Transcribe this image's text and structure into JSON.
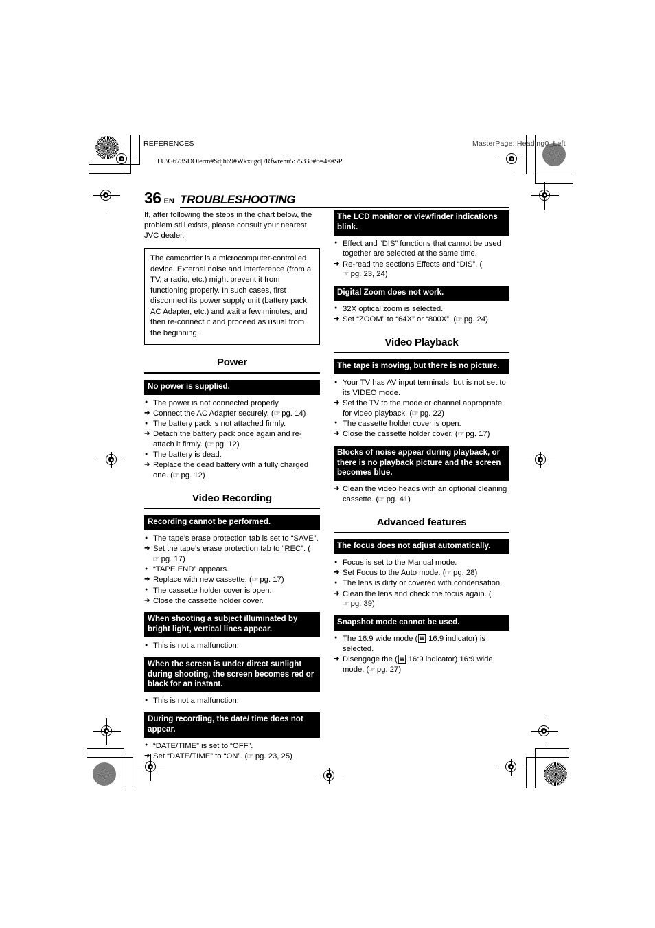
{
  "header": {
    "left_label": "REFERENCES",
    "garbled_line": "J U\\G673SDOlerrn#Sdjh69#Wkxugd| /Rfwrehu5: /5338#6=4<#SP",
    "right_label": "MasterPage: Heading0_Left"
  },
  "page": {
    "number": "36",
    "language": "EN",
    "title": "TROUBLESHOOTING"
  },
  "intro": "If, after following the steps in the chart below, the problem still exists, please consult your nearest JVC dealer.",
  "note_box": "The camcorder is a microcomputer-controlled device. External noise and interference (from a TV, a radio, etc.) might prevent it from functioning properly. In such cases, first disconnect its power supply unit (battery pack, AC Adapter, etc.) and wait a few minutes; and then re-connect it and proceed as usual from the beginning.",
  "sections": {
    "power": {
      "heading": "Power",
      "problems": [
        {
          "title": "No power is supplied.",
          "items": [
            {
              "type": "bullet",
              "text": "The power is not connected properly."
            },
            {
              "type": "arrow",
              "text": "Connect the AC Adapter securely. (",
              "ref": "pg. 14",
              "tail": ")"
            },
            {
              "type": "bullet",
              "text": "The battery pack is not attached firmly."
            },
            {
              "type": "arrow",
              "text": "Detach the battery pack once again and re-attach it firmly. (",
              "ref": "pg. 12",
              "tail": ")"
            },
            {
              "type": "bullet",
              "text": "The battery is dead."
            },
            {
              "type": "arrow",
              "text": "Replace the dead battery with a fully charged one. (",
              "ref": "pg. 12",
              "tail": ")"
            }
          ]
        }
      ]
    },
    "video_recording": {
      "heading": "Video Recording",
      "problems": [
        {
          "title": "Recording cannot be performed.",
          "items": [
            {
              "type": "bullet",
              "text": "The tape’s erase protection tab is set to “SAVE”."
            },
            {
              "type": "arrow",
              "text": "Set the tape’s erase protection tab to “REC”. (",
              "ref": "pg. 17",
              "tail": ")"
            },
            {
              "type": "bullet",
              "text": "“TAPE END” appears."
            },
            {
              "type": "arrow",
              "text": "Replace with new cassette. (",
              "ref": "pg. 17",
              "tail": ")"
            },
            {
              "type": "bullet",
              "text": "The cassette holder cover is open."
            },
            {
              "type": "arrow",
              "text": "Close the cassette holder cover."
            }
          ]
        },
        {
          "title": "When shooting a subject illuminated by bright light, vertical lines appear.",
          "items": [
            {
              "type": "bullet",
              "text": "This is not a malfunction."
            }
          ]
        },
        {
          "title": "When the screen is under direct sunlight during shooting, the screen becomes red or black for an instant.",
          "items": [
            {
              "type": "bullet",
              "text": "This is not a malfunction."
            }
          ]
        },
        {
          "title": "During recording, the date/ time does not appear.",
          "items": [
            {
              "type": "bullet",
              "text": "“DATE/TIME” is set to “OFF”."
            },
            {
              "type": "arrow",
              "text": "Set “DATE/TIME” to “ON”. (",
              "ref": "pg. 23, 25",
              "tail": ")"
            }
          ]
        }
      ]
    },
    "right_top": {
      "problems": [
        {
          "title": "The LCD monitor or viewfinder indications blink.",
          "items": [
            {
              "type": "bullet",
              "text": "Effect and “DIS” functions that cannot be used together are selected at the same time."
            },
            {
              "type": "arrow",
              "text": "Re-read the sections Effects and “DIS”. (",
              "ref": "pg. 23, 24",
              "tail": ")"
            }
          ]
        },
        {
          "title": "Digital Zoom does not work.",
          "items": [
            {
              "type": "bullet",
              "text": "32X optical zoom is selected."
            },
            {
              "type": "arrow",
              "text": "Set “ZOOM” to “64X” or “800X”. (",
              "ref": "pg. 24",
              "tail": ")"
            }
          ]
        }
      ]
    },
    "video_playback": {
      "heading": "Video Playback",
      "problems": [
        {
          "title": "The tape is moving, but there is no picture.",
          "items": [
            {
              "type": "bullet",
              "text": "Your TV has AV input terminals, but is not set to its VIDEO mode."
            },
            {
              "type": "arrow",
              "text": "Set the TV to the mode or channel appropriate for video playback. (",
              "ref": "pg. 22",
              "tail": ")"
            },
            {
              "type": "bullet",
              "text": "The cassette holder cover is open."
            },
            {
              "type": "arrow",
              "text": "Close the cassette holder cover. (",
              "ref": "pg. 17",
              "tail": ")"
            }
          ]
        },
        {
          "title": "Blocks of noise appear during playback, or there is no playback picture and the screen becomes blue.",
          "items": [
            {
              "type": "arrow",
              "text": "Clean the video heads with an optional cleaning cassette. (",
              "ref": "pg. 41",
              "tail": ")"
            }
          ]
        }
      ]
    },
    "advanced_features": {
      "heading": "Advanced features",
      "problems": [
        {
          "title": "The focus does not adjust automatically.",
          "items": [
            {
              "type": "bullet",
              "text": "Focus is set to the Manual mode."
            },
            {
              "type": "arrow",
              "text": "Set Focus to the Auto mode. (",
              "ref": "pg. 28",
              "tail": ")"
            },
            {
              "type": "bullet",
              "text": "The lens is dirty or covered with condensation."
            },
            {
              "type": "arrow",
              "text": "Clean the lens and check the focus again. (",
              "ref": "pg. 39",
              "tail": ")"
            }
          ]
        },
        {
          "title": "Snapshot mode cannot be used.",
          "items": [
            {
              "type": "bullet_wide",
              "pre": "The 16:9 wide mode (",
              "icon": "W",
              "post": " 16:9 indicator) is selected."
            },
            {
              "type": "arrow_wide",
              "pre": "Disengage the (",
              "icon": "W",
              "post": " 16:9 indicator) 16:9 wide mode. (",
              "ref": "pg. 27",
              "tail": ")"
            }
          ]
        }
      ]
    }
  }
}
